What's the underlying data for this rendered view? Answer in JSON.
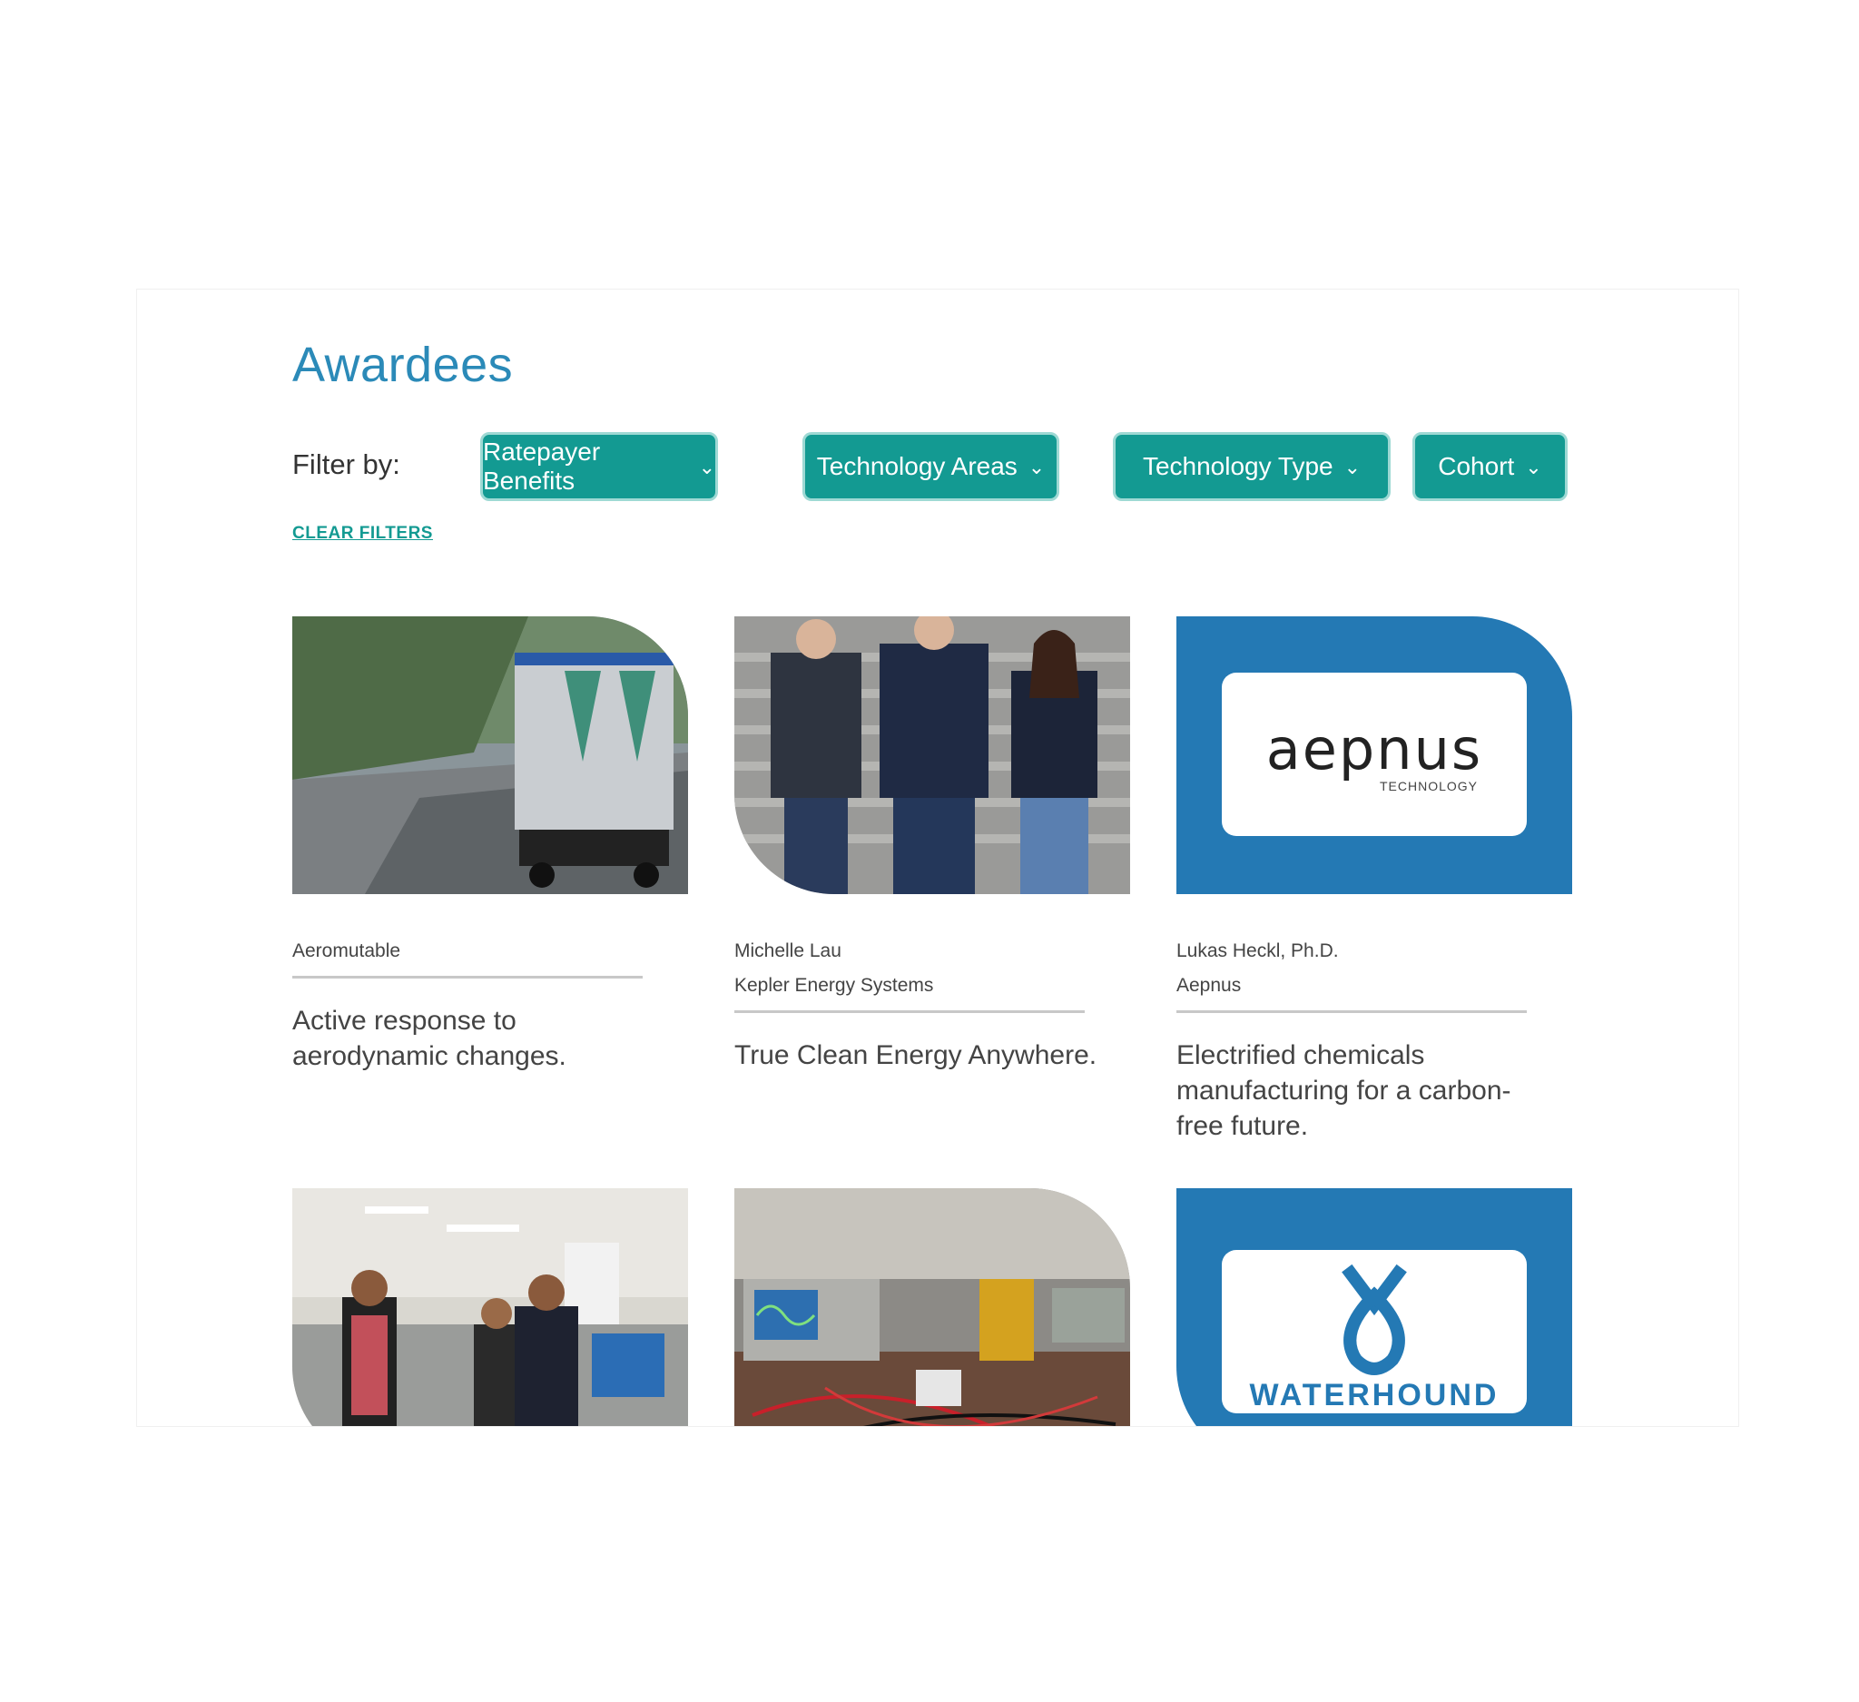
{
  "page": {
    "title": "Awardees"
  },
  "filters": {
    "label": "Filter by:",
    "buttons": [
      {
        "label": "Ratepayer Benefits"
      },
      {
        "label": "Technology Areas"
      },
      {
        "label": "Technology Type"
      },
      {
        "label": "Cohort"
      }
    ],
    "clear_label": "CLEAR FILTERS"
  },
  "awardees": [
    {
      "name": "Aeromutable",
      "company": "",
      "description": "Active response to aerodynamic changes."
    },
    {
      "name": "Michelle Lau",
      "company": "Kepler Energy Systems",
      "description": "True Clean Energy Anywhere."
    },
    {
      "name": "Lukas Heckl, Ph.D.",
      "company": "Aepnus",
      "description": "Electrified chemicals manufacturing for a carbon-free future.",
      "logo_text": "aepnus",
      "logo_subtext": "TECHNOLOGY"
    },
    {
      "name": "",
      "company": "",
      "description": ""
    },
    {
      "name": "",
      "company": "",
      "description": ""
    },
    {
      "name": "",
      "company": "",
      "description": "",
      "logo_text": "WATERHOUND"
    }
  ],
  "colors": {
    "accent": "#139a92",
    "title": "#2b8ab8",
    "logo_bg": "#2479b4",
    "aepnus_yellow": "#f4c21d"
  },
  "icons": {
    "dropdown": "chevron-down-icon"
  }
}
